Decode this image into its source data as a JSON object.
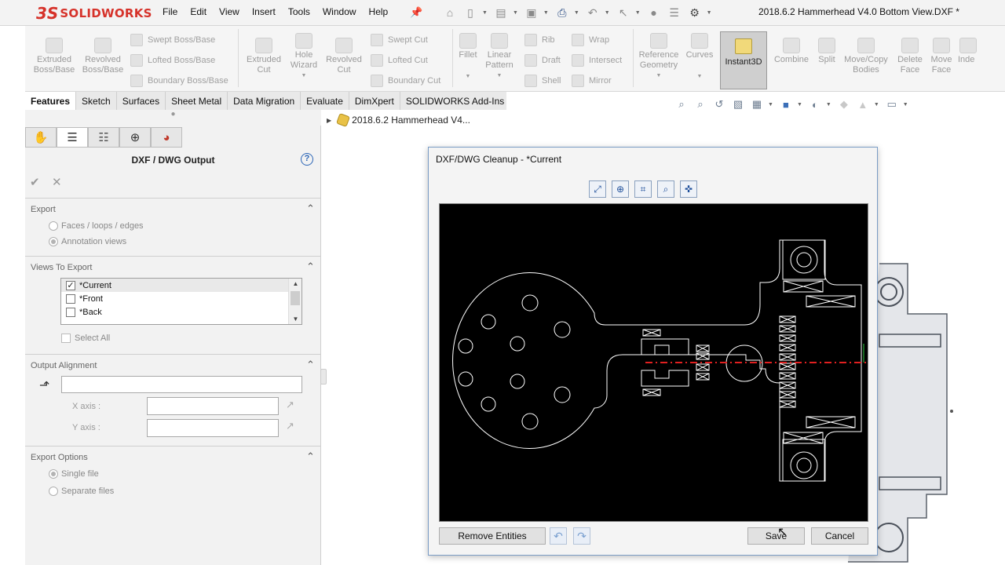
{
  "app": {
    "logo_prefix": "3S",
    "logo_name": "SOLIDWORKS",
    "document_title": "2018.6.2 Hammerhead V4.0 Bottom View.DXF *"
  },
  "menu": [
    "File",
    "Edit",
    "View",
    "Insert",
    "Tools",
    "Window",
    "Help"
  ],
  "ribbon": {
    "extruded_boss": "Extruded Boss/Base",
    "revolved_boss": "Revolved Boss/Base",
    "swept_boss": "Swept Boss/Base",
    "lofted_boss": "Lofted Boss/Base",
    "boundary_boss": "Boundary Boss/Base",
    "extruded_cut": "Extruded Cut",
    "hole_wizard": "Hole Wizard",
    "revolved_cut": "Revolved Cut",
    "swept_cut": "Swept Cut",
    "lofted_cut": "Lofted Cut",
    "boundary_cut": "Boundary Cut",
    "fillet": "Fillet",
    "linear_pattern": "Linear Pattern",
    "rib": "Rib",
    "draft": "Draft",
    "shell": "Shell",
    "wrap": "Wrap",
    "intersect": "Intersect",
    "mirror": "Mirror",
    "reference_geometry": "Reference Geometry",
    "curves": "Curves",
    "instant3d": "Instant3D",
    "combine": "Combine",
    "split": "Split",
    "move_copy_bodies": "Move/Copy Bodies",
    "delete_face": "Delete Face",
    "move_face": "Move Face",
    "indent": "Inde"
  },
  "tabs": [
    "Features",
    "Sketch",
    "Surfaces",
    "Sheet Metal",
    "Data Migration",
    "Evaluate",
    "DimXpert",
    "SOLIDWORKS Add-Ins"
  ],
  "property_manager": {
    "title": "DXF / DWG Output",
    "help": "?",
    "export": {
      "header": "Export",
      "option_faces": "Faces / loops / edges",
      "option_annotation": "Annotation views"
    },
    "views_to_export": {
      "header": "Views To Export",
      "items": [
        {
          "label": "*Current",
          "checked": true
        },
        {
          "label": "*Front",
          "checked": false
        },
        {
          "label": "*Back",
          "checked": false
        }
      ],
      "select_all": "Select All"
    },
    "output_alignment": {
      "header": "Output Alignment",
      "x_axis_label": "X axis :",
      "y_axis_label": "Y axis :"
    },
    "export_options": {
      "header": "Export Options",
      "single_file": "Single file",
      "separate_files": "Separate files"
    }
  },
  "feature_tree": {
    "root": "2018.6.2 Hammerhead V4..."
  },
  "dialog": {
    "title": "DXF/DWG Cleanup - *Current",
    "remove_entities": "Remove Entities",
    "save": "Save",
    "cancel": "Cancel"
  },
  "colors": {
    "logo_red": "#d6322a",
    "accent_blue": "#2b65b6",
    "canvas_bg": "#000000",
    "axis_red": "#e02020"
  }
}
